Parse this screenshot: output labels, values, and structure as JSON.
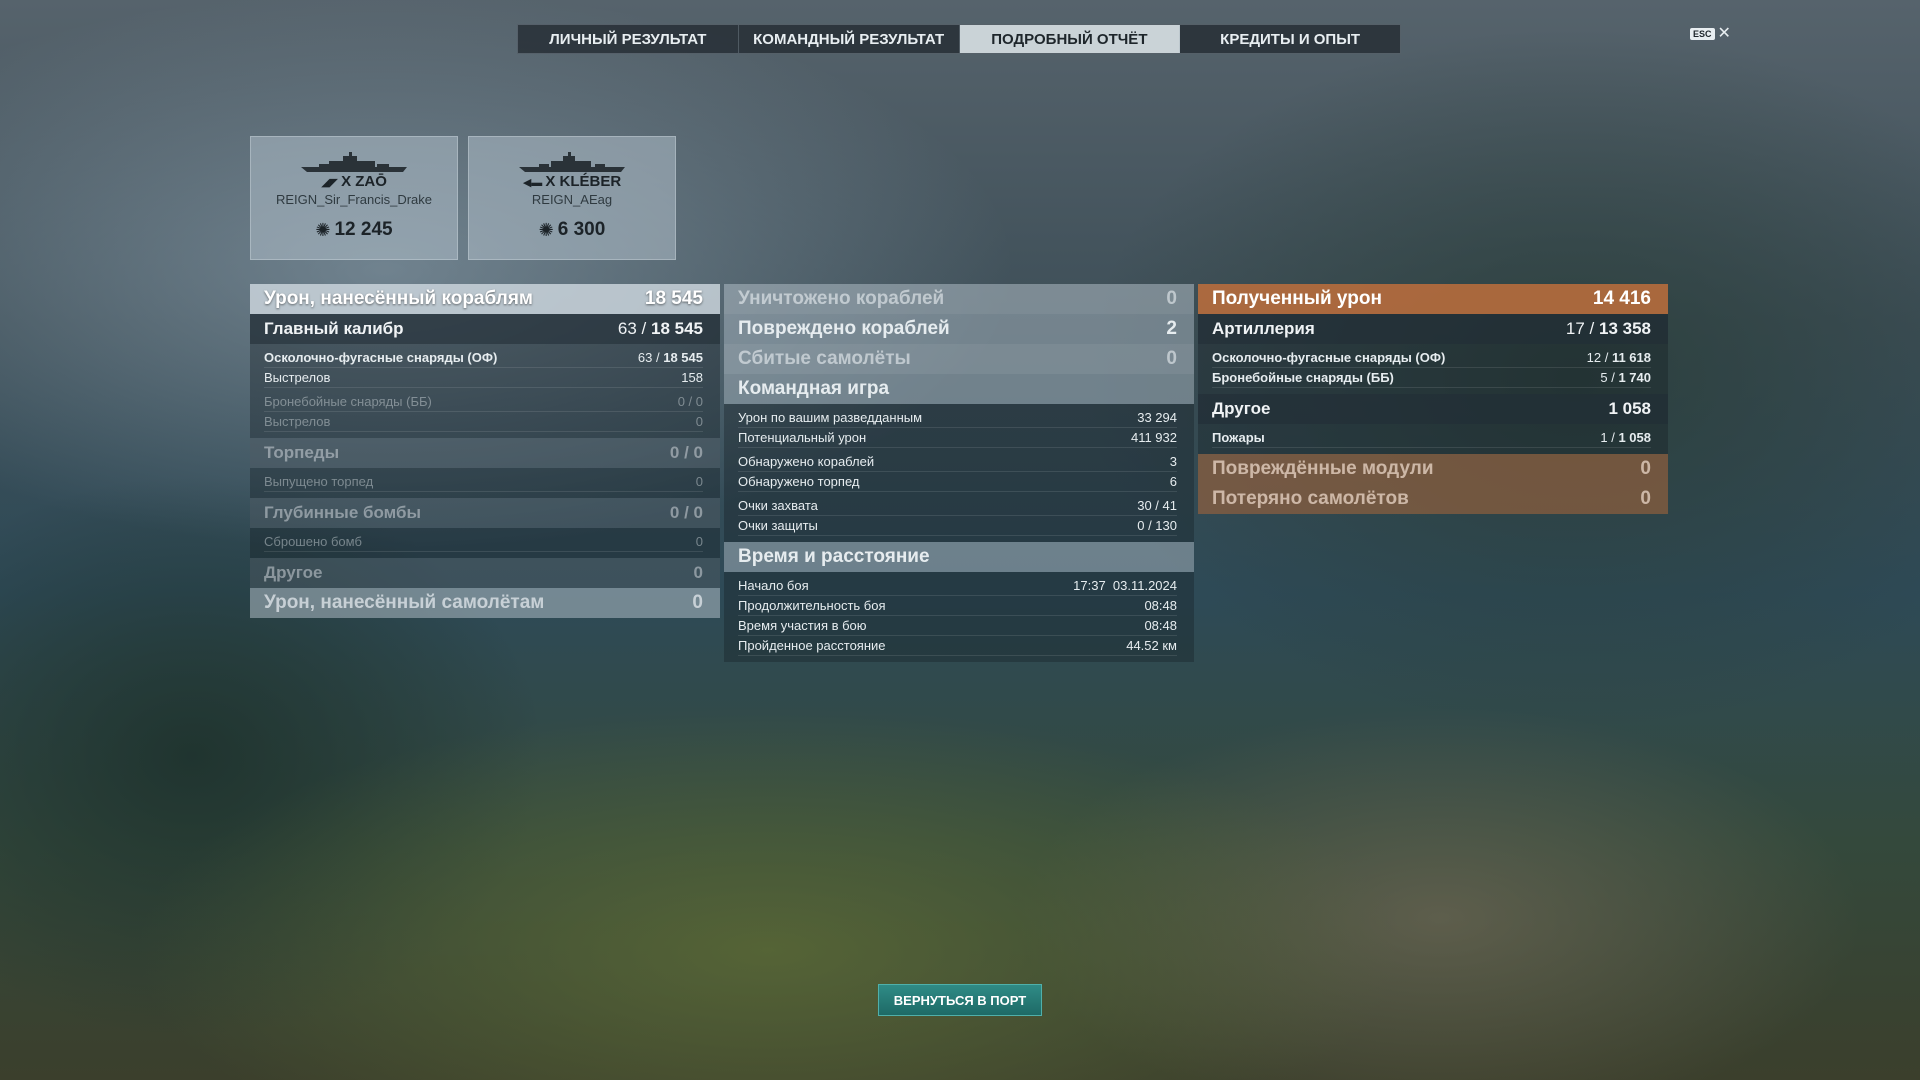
{
  "tabs": [
    {
      "label": "ЛИЧНЫЙ РЕЗУЛЬТАТ"
    },
    {
      "label": "КОМАНДНЫЙ РЕЗУЛЬТАТ"
    },
    {
      "label": "ПОДРОБНЫЙ ОТЧЁТ"
    },
    {
      "label": "КРЕДИТЫ И ОПЫТ"
    }
  ],
  "esc": {
    "key": "ESC",
    "close": "✕"
  },
  "cards": [
    {
      "ship": "X ZAŌ",
      "player": "REIGN_Sir_Francis_Drake",
      "damage": "12 245"
    },
    {
      "ship": "X KLÉBER",
      "player": "REIGN_AEag",
      "damage": "6 300"
    }
  ],
  "left": {
    "dealt": {
      "label": "Урон, нанесённый кораблям",
      "value": "18 545"
    },
    "main": {
      "label": "Главный калибр",
      "hits": "63 /",
      "value": "18 545"
    },
    "he": {
      "label": "Осколочно-фугасные снаряды (ОФ)",
      "hits": "63 /",
      "value": "18 545"
    },
    "he_shots": {
      "label": "Выстрелов",
      "value": "158"
    },
    "ap": {
      "label": "Бронебойные снаряды (ББ)",
      "value": "0 / 0"
    },
    "ap_shots": {
      "label": "Выстрелов",
      "value": "0"
    },
    "torp": {
      "label": "Торпеды",
      "value": "0 / 0"
    },
    "torp_fired": {
      "label": "Выпущено торпед",
      "value": "0"
    },
    "dc": {
      "label": "Глубинные бомбы",
      "value": "0 / 0"
    },
    "dc_dropped": {
      "label": "Сброшено бомб",
      "value": "0"
    },
    "other": {
      "label": "Другое",
      "value": "0"
    },
    "planes": {
      "label": "Урон, нанесённый самолётам",
      "value": "0"
    }
  },
  "mid": {
    "destroyed": {
      "label": "Уничтожено кораблей",
      "value": "0"
    },
    "damaged": {
      "label": "Повреждено кораблей",
      "value": "2"
    },
    "shot_planes": {
      "label": "Сбитые самолёты",
      "value": "0"
    },
    "team": {
      "label": "Командная игра"
    },
    "spot_dmg": {
      "label": "Урон по вашим разведданным",
      "value": "33 294"
    },
    "potential": {
      "label": "Потенциальный урон",
      "value": "411 932"
    },
    "spotted_ships": {
      "label": "Обнаружено кораблей",
      "value": "3"
    },
    "spotted_torps": {
      "label": "Обнаружено торпед",
      "value": "6"
    },
    "cap": {
      "label": "Очки захвата",
      "value": "30 / 41"
    },
    "def": {
      "label": "Очки защиты",
      "value": "0 / 130"
    },
    "time": {
      "label": "Время и расстояние"
    },
    "start": {
      "label": "Начало боя",
      "value": "17:37  03.11.2024"
    },
    "duration": {
      "label": "Продолжительность боя",
      "value": "08:48"
    },
    "participation": {
      "label": "Время участия в бою",
      "value": "08:48"
    },
    "distance": {
      "label": "Пройденное расстояние",
      "value": "44.52 км"
    }
  },
  "right": {
    "received": {
      "label": "Полученный урон",
      "value": "14 416"
    },
    "artillery": {
      "label": "Артиллерия",
      "hits": "17 /",
      "value": "13 358"
    },
    "he": {
      "label": "Осколочно-фугасные снаряды (ОФ)",
      "hits": "12 /",
      "value": "11 618"
    },
    "ap": {
      "label": "Бронебойные снаряды (ББ)",
      "hits": "5 /",
      "value": "1 740"
    },
    "other": {
      "label": "Другое",
      "value": "1 058"
    },
    "fires": {
      "label": "Пожары",
      "hits": "1 /",
      "value": "1 058"
    },
    "modules": {
      "label": "Повреждённые модули",
      "value": "0"
    },
    "lost_planes": {
      "label": "Потеряно самолётов",
      "value": "0"
    }
  },
  "port_button": {
    "label": "ВЕРНУТЬСЯ В ПОРТ"
  },
  "colors": {
    "accent_teal": "#2f8b86",
    "received_orange": "#be6e3c"
  }
}
